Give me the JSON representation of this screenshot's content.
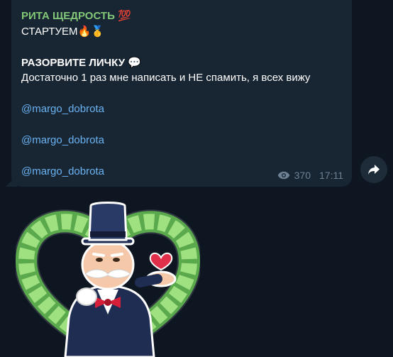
{
  "message": {
    "sender": "РИТА ЩЕДРОСТЬ",
    "sender_emoji": "💯",
    "line1": "СТАРТУЕМ",
    "line1_emoji": "🔥🥇",
    "heading": "РАЗОРВИТЕ ЛИЧКУ",
    "heading_emoji": "💬",
    "body": "Достаточно 1 раз мне написать и НЕ спамить, я всех вижу",
    "links": [
      "@margo_dobrota",
      "@margo_dobrota",
      "@margo_dobrota"
    ],
    "views": "370",
    "time": "17:11"
  },
  "icons": {
    "views": "eye-icon",
    "forward": "forward-arrow-icon"
  },
  "colors": {
    "background": "#0e1621",
    "bubble": "#182533",
    "sender": "#82c777",
    "link": "#6ab3f3",
    "meta": "#6d8295"
  }
}
